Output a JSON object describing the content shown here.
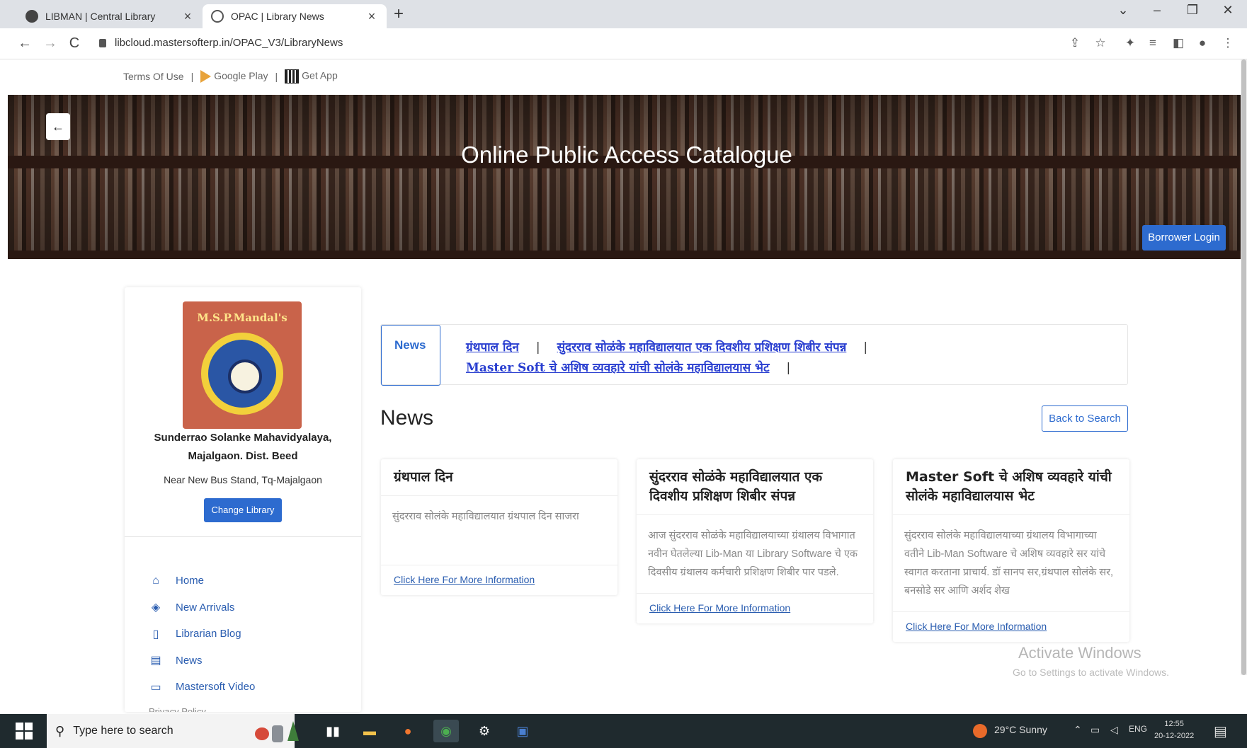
{
  "browser": {
    "tabs": [
      {
        "title": "LIBMAN | Central Library",
        "close": "×"
      },
      {
        "title": "OPAC | Library News",
        "close": "×"
      }
    ],
    "new_tab": "+",
    "url": "libcloud.mastersofterp.in/OPAC_V3/LibraryNews",
    "controls": {
      "dropdown": "⌄",
      "minimize": "–",
      "restore": "❐",
      "close": "✕"
    },
    "nav": {
      "back": "←",
      "forward": "→",
      "reload": "C"
    }
  },
  "top_links": {
    "terms": "Terms Of Use",
    "sep": "|",
    "google_play": "Google Play",
    "get_app": "Get App"
  },
  "hero": {
    "title": "Online Public Access Catalogue",
    "back_icon": "←",
    "borrower_login": "Borrower Login"
  },
  "sidebar": {
    "logo_text": "M.S.P.Mandal's",
    "institution_name": "Sunderrao Solanke Mahavidyalaya, Majalgaon. Dist. Beed",
    "address": "Near New Bus Stand, Tq-Majalgaon",
    "change_library": "Change Library",
    "nav": [
      {
        "label": "Home",
        "icon": "home-icon"
      },
      {
        "label": "New Arrivals",
        "icon": "diamond-icon"
      },
      {
        "label": "Librarian Blog",
        "icon": "book-icon"
      },
      {
        "label": "News",
        "icon": "document-icon"
      },
      {
        "label": "Mastersoft Video",
        "icon": "video-icon"
      }
    ],
    "privacy": "Privacy Policy"
  },
  "ticker": {
    "tag": "News",
    "items": [
      "ग्रंथपाल दिन",
      "सुंदरराव सोळंके महाविद्यालयात एक दिवशीय प्रशिक्षण शिबीर संपन्न",
      "Master Soft चे अशिष व्यवहारे यांची सोलंके महाविद्यालयास भेट"
    ],
    "separator": "|"
  },
  "news": {
    "heading": "News",
    "back_to_search": "Back to Search",
    "cards": [
      {
        "title": "ग्रंथपाल दिन",
        "body": "सुंदरराव सोलंके महाविद्यालयात ग्रंथपाल दिन साजरा",
        "link": "Click Here For More Information"
      },
      {
        "title": "सुंदरराव सोळंके महाविद्यालयात एक दिवशीय प्रशिक्षण शिबीर संपन्न",
        "body": "आज सुंदरराव सोळंके महाविद्यालयाच्या ग्रंथालय विभागात नवीन घेतलेल्या Lib-Man या Library Software चे एक दिवसीय ग्रंथालय कर्मचारी प्रशिक्षण शिबीर पार पडले.",
        "link": "Click Here For More Information"
      },
      {
        "title": "Master Soft चे अशिष व्यवहारे यांची सोलंके महाविद्यालयास भेट",
        "body": "सुंदरराव सोलंके महाविद्यालयाच्या ग्रंथालय विभागाच्या वतीने Lib-Man Software चे अशिष व्यवहारे सर यांचे स्वागत करताना प्राचार्य. डॉ सानप सर,ग्रंथपाल सोलंके सर, बनसोडे सर आणि अर्शद शेख",
        "link": "Click Here For More Information"
      }
    ]
  },
  "watermark": {
    "line1": "Activate Windows",
    "line2": "Go to Settings to activate Windows."
  },
  "taskbar": {
    "search_placeholder": "Type here to search",
    "weather": "29°C  Sunny",
    "lang": "ENG",
    "time": "12:55",
    "date": "20-12-2022"
  }
}
